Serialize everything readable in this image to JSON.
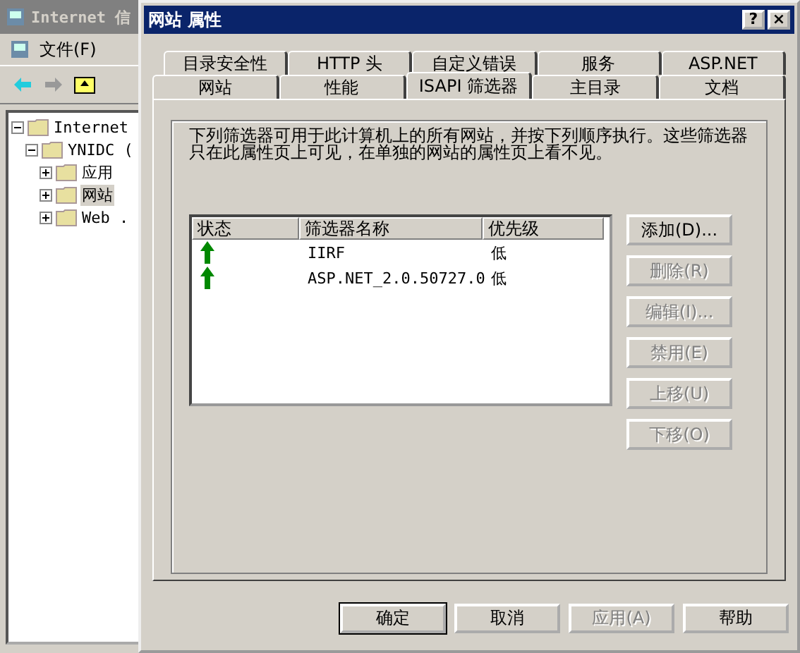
{
  "background_window": {
    "title": "Internet 信",
    "menu": [
      "文件(F)"
    ],
    "tree": [
      {
        "label": "Internet",
        "expanded": true,
        "selected": false,
        "children": [
          {
            "label": "YNIDC (",
            "expanded": true,
            "selected": false,
            "children": [
              {
                "label": "应用",
                "expanded": false,
                "selected": false
              },
              {
                "label": "网站",
                "expanded": false,
                "selected": true
              },
              {
                "label": "Web .",
                "expanded": false,
                "selected": false
              }
            ]
          }
        ]
      }
    ]
  },
  "dialog": {
    "title": "网站 属性",
    "help_button": "?",
    "close_button": "×",
    "tab_rows": [
      [
        {
          "label": "目录安全性",
          "selected": false
        },
        {
          "label": "HTTP 头",
          "selected": false
        },
        {
          "label": "自定义错误",
          "selected": false
        },
        {
          "label": "服务",
          "selected": false
        },
        {
          "label": "ASP.NET",
          "selected": false
        }
      ],
      [
        {
          "label": "网站",
          "selected": false
        },
        {
          "label": "性能",
          "selected": false
        },
        {
          "label": "ISAPI 筛选器",
          "selected": true
        },
        {
          "label": "主目录",
          "selected": false
        },
        {
          "label": "文档",
          "selected": false
        }
      ]
    ],
    "description": "下列筛选器可用于此计算机上的所有网站，并按下列顺序执行。这些筛选器只在此属性页上可见，在单独的网站的属性页上看不见。",
    "filter_table": {
      "columns": [
        "状态",
        "筛选器名称",
        "优先级"
      ],
      "rows": [
        {
          "enabled": true,
          "name": "IIRF",
          "priority": "低"
        },
        {
          "enabled": true,
          "name": "ASP.NET_2.0.50727.0",
          "priority": "低"
        }
      ]
    },
    "side_buttons": [
      {
        "label": "添加(D)...",
        "disabled": false
      },
      {
        "label": "删除(R)",
        "disabled": true
      },
      {
        "label": "编辑(I)...",
        "disabled": true
      },
      {
        "label": "禁用(E)",
        "disabled": true
      },
      {
        "label": "上移(U)",
        "disabled": true
      },
      {
        "label": "下移(O)",
        "disabled": true
      }
    ],
    "footer_buttons": [
      {
        "label": "确定",
        "disabled": false,
        "default": true
      },
      {
        "label": "取消",
        "disabled": false,
        "default": false
      },
      {
        "label": "应用(A)",
        "disabled": true,
        "default": false
      },
      {
        "label": "帮助",
        "disabled": false,
        "default": false
      }
    ]
  }
}
